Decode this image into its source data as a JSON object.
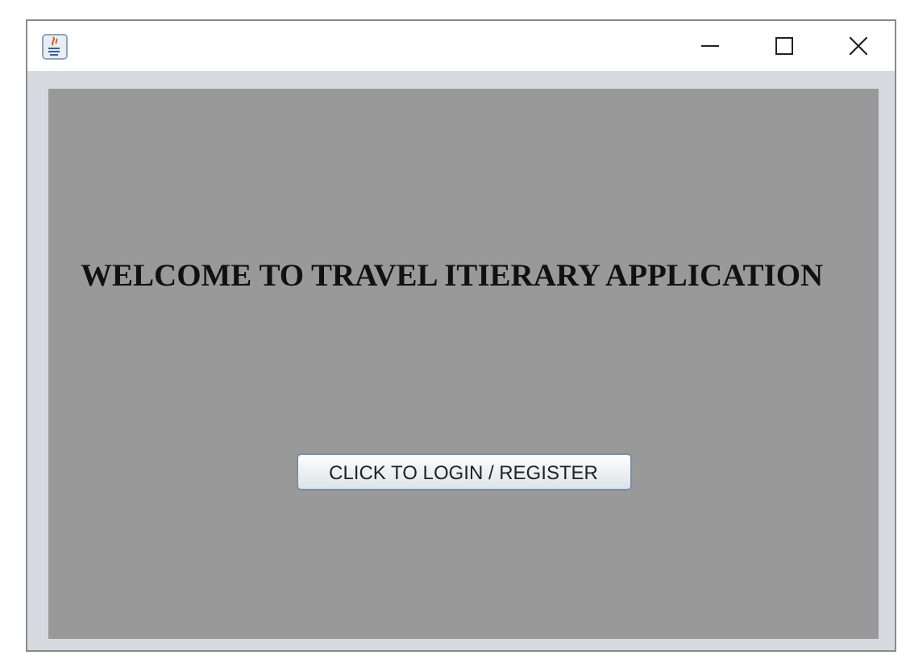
{
  "window": {
    "title_bar": {
      "controls": [
        {
          "kind": "minimize"
        },
        {
          "kind": "maximize"
        },
        {
          "kind": "close"
        }
      ]
    }
  },
  "panel": {
    "heading": "WELCOME TO TRAVEL ITIERARY APPLICATION",
    "button": "CLICK TO LOGIN / REGISTER"
  }
}
